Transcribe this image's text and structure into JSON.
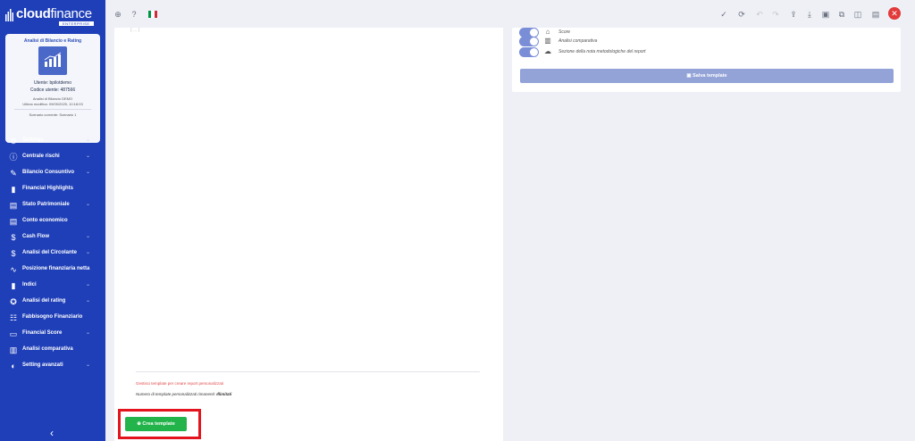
{
  "brand": {
    "word1": "cloud",
    "word2": "finance",
    "edition": "ENTERPRISE"
  },
  "card": {
    "title": "Analisi di Bilancio e Rating",
    "user_line": "Utente: bpilotdemo",
    "code_line": "Codice utente: 487566",
    "company_line": "Analisi di Bilancio DEMO",
    "modified_line": "Ultima modifica: 09/05/2025, 10:18:03",
    "scenario_line": "Scenario corrente: Scenario 1"
  },
  "nav": [
    {
      "label": "Settings",
      "icon": "gear-icon",
      "glyph": "⚙",
      "chevron": true
    },
    {
      "label": "Centrale rischi",
      "icon": "info-circle-icon",
      "glyph": "ⓘ",
      "chevron": true
    },
    {
      "label": "Bilancio Consuntivo",
      "icon": "edit-icon",
      "glyph": "✎",
      "chevron": true
    },
    {
      "label": "Financial Highlights",
      "icon": "bar-chart-icon",
      "glyph": "▮",
      "chevron": false
    },
    {
      "label": "Stato Patrimoniale",
      "icon": "document-icon",
      "glyph": "▤",
      "chevron": true
    },
    {
      "label": "Conto economico",
      "icon": "document-icon",
      "glyph": "▤",
      "chevron": false
    },
    {
      "label": "Cash Flow",
      "icon": "dollar-icon",
      "glyph": "$",
      "chevron": true
    },
    {
      "label": "Analisi del Circolante",
      "icon": "dollar-icon",
      "glyph": "$",
      "chevron": true
    },
    {
      "label": "Posizione finanziaria netta",
      "icon": "pulse-icon",
      "glyph": "∿",
      "chevron": false
    },
    {
      "label": "Indici",
      "icon": "bar-chart-icon",
      "glyph": "▮",
      "chevron": true
    },
    {
      "label": "Analisi del rating",
      "icon": "badge-icon",
      "glyph": "✪",
      "chevron": true
    },
    {
      "label": "Fabbisogno Finanziario",
      "icon": "sliders-icon",
      "glyph": "☷",
      "chevron": false
    },
    {
      "label": "Financial Score",
      "icon": "monitor-icon",
      "glyph": "▭",
      "chevron": true
    },
    {
      "label": "Analisi comparativa",
      "icon": "book-icon",
      "glyph": "▥",
      "chevron": false
    },
    {
      "label": "Setting avanzati",
      "icon": "toggle-icon",
      "glyph": "◐",
      "chevron": true
    }
  ],
  "topbar": {
    "flag_colors": [
      "#009246",
      "#ffffff",
      "#ce2b37"
    ]
  },
  "left_panel": {
    "top_label": "( ... )",
    "info_red": "Gestisci template per creare report personalizzati",
    "info_text": "Numero di template personalizzati rimanenti: ",
    "info_bold": "Illimitati",
    "create_button": "Crea template"
  },
  "right_panel": {
    "rows": [
      {
        "label": "Score",
        "icon": "home-icon",
        "glyph": "⌂"
      },
      {
        "label": "Analisi comparativa",
        "icon": "book-icon",
        "glyph": "▥"
      },
      {
        "label": "Sezione della nota metodologiche del report",
        "icon": "cloud-icon",
        "glyph": "☁"
      }
    ],
    "save_button": "Salva template"
  },
  "colors": {
    "sidebar": "#1f3fb8",
    "accent_green": "#22b34a",
    "highlight": "#e4141e",
    "save_button": "#93a3d8"
  }
}
